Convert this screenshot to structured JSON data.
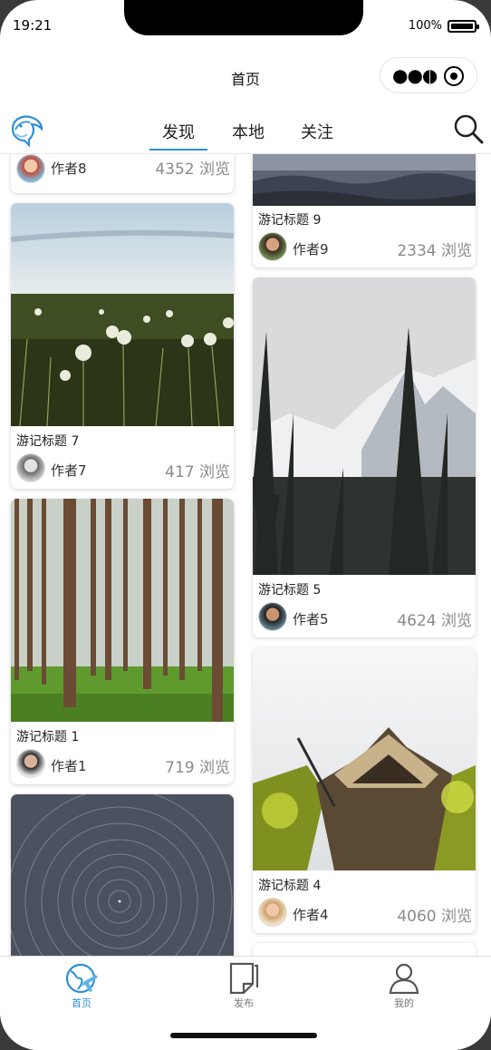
{
  "status_bar": {
    "time": "19:21",
    "battery_percent": "100%",
    "battery_level": 1.0
  },
  "nav": {
    "title": "首页"
  },
  "top_tabs": [
    {
      "label": "发现",
      "active": true
    },
    {
      "label": "本地",
      "active": false
    },
    {
      "label": "关注",
      "active": false
    }
  ],
  "cards": {
    "c8": {
      "author": "作者8",
      "views": "4352 浏览"
    },
    "c9": {
      "title": "游记标题 9",
      "author": "作者9",
      "views": "2334 浏览"
    },
    "c7": {
      "title": "游记标题 7",
      "author": "作者7",
      "views": "417 浏览"
    },
    "c5": {
      "title": "游记标题 5",
      "author": "作者5",
      "views": "4624 浏览"
    },
    "c1": {
      "title": "游记标题 1",
      "author": "作者1",
      "views": "719 浏览"
    },
    "c4": {
      "title": "游记标题 4",
      "author": "作者4",
      "views": "4060 浏览"
    }
  },
  "bottom_nav": [
    {
      "label": "首页",
      "icon": "globe-plane-icon",
      "active": true
    },
    {
      "label": "发布",
      "icon": "document-icon",
      "active": false
    },
    {
      "label": "我的",
      "icon": "user-icon",
      "active": false
    }
  ],
  "colors": {
    "accent": "#2d8fd5"
  }
}
